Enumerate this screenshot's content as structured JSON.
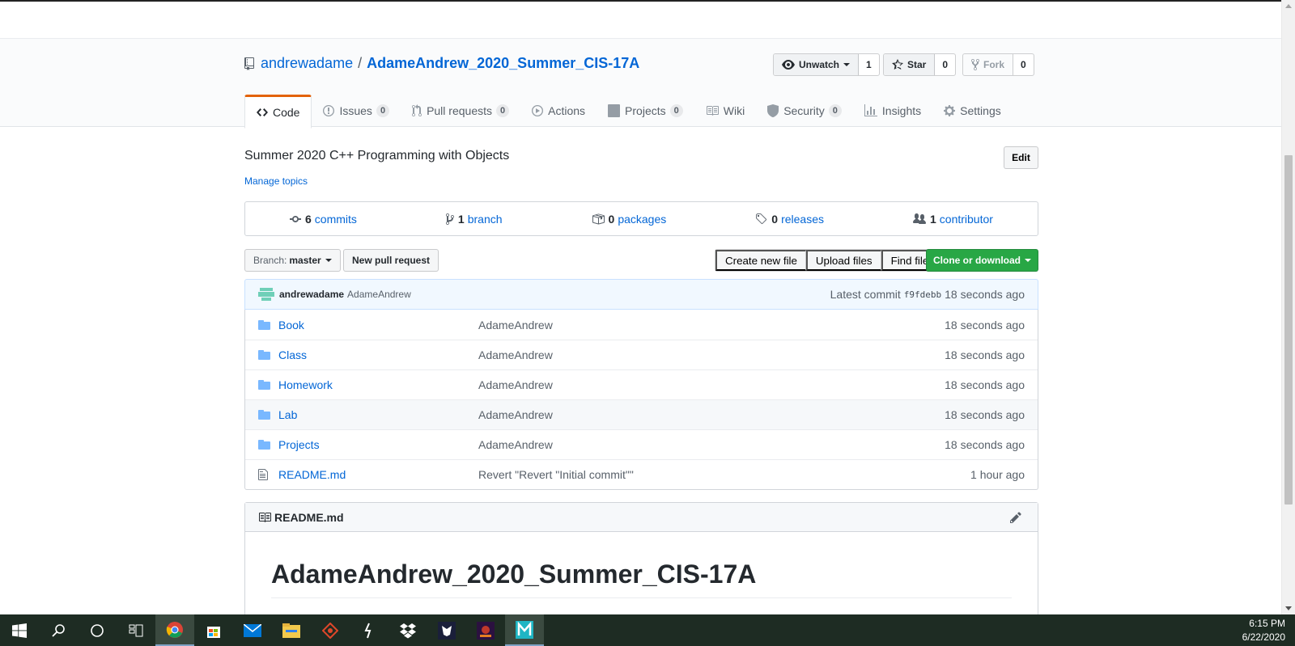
{
  "repo": {
    "owner": "andrewadame",
    "separator": "/",
    "name": "AdameAndrew_2020_Summer_CIS-17A"
  },
  "actions": {
    "watch_label": "Unwatch",
    "watch_count": "1",
    "star_label": "Star",
    "star_count": "0",
    "fork_label": "Fork",
    "fork_count": "0"
  },
  "tabs": [
    {
      "label": "Code",
      "count": "",
      "icon": "code-icon"
    },
    {
      "label": "Issues",
      "count": "0",
      "icon": "issue-icon"
    },
    {
      "label": "Pull requests",
      "count": "0",
      "icon": "pull-request-icon"
    },
    {
      "label": "Actions",
      "count": "",
      "icon": "play-icon"
    },
    {
      "label": "Projects",
      "count": "0",
      "icon": "project-icon"
    },
    {
      "label": "Wiki",
      "count": "",
      "icon": "book-icon"
    },
    {
      "label": "Security",
      "count": "0",
      "icon": "shield-icon"
    },
    {
      "label": "Insights",
      "count": "",
      "icon": "graph-icon"
    },
    {
      "label": "Settings",
      "count": "",
      "icon": "gear-icon"
    }
  ],
  "description": "Summer 2020 C++ Programming with Objects",
  "manage_topics": "Manage topics",
  "edit_label": "Edit",
  "summary": {
    "commits_num": "6",
    "commits_label": "commits",
    "branch_num": "1",
    "branch_label": "branch",
    "packages_num": "0",
    "packages_label": "packages",
    "releases_num": "0",
    "releases_label": "releases",
    "contributor_num": "1",
    "contributor_label": "contributor"
  },
  "toolbar": {
    "branch_prefix": "Branch:",
    "branch_name": "master",
    "new_pr": "New pull request",
    "create_file": "Create new file",
    "upload_files": "Upload files",
    "find_file": "Find file",
    "clone": "Clone or download"
  },
  "commit": {
    "author": "andrewadame",
    "message": "AdameAndrew",
    "latest_prefix": "Latest commit",
    "sha": "f9fdebb",
    "age": "18 seconds ago"
  },
  "files": [
    {
      "name": "Book",
      "type": "folder",
      "message": "AdameAndrew",
      "age": "18 seconds ago"
    },
    {
      "name": "Class",
      "type": "folder",
      "message": "AdameAndrew",
      "age": "18 seconds ago"
    },
    {
      "name": "Homework",
      "type": "folder",
      "message": "AdameAndrew",
      "age": "18 seconds ago"
    },
    {
      "name": "Lab",
      "type": "folder",
      "message": "AdameAndrew",
      "age": "18 seconds ago"
    },
    {
      "name": "Projects",
      "type": "folder",
      "message": "AdameAndrew",
      "age": "18 seconds ago"
    },
    {
      "name": "README.md",
      "type": "file",
      "message": "Revert \"Revert \"Initial commit\"\"",
      "age": "1 hour ago"
    }
  ],
  "readme": {
    "filename": "README.md",
    "heading": "AdameAndrew_2020_Summer_CIS-17A"
  },
  "taskbar": {
    "time": "6:15 PM",
    "date": "6/22/2020"
  },
  "colors": {
    "link": "#0366d6",
    "accent_tab": "#e36209",
    "clone_green": "#28a745",
    "taskbar": "#1e2c23"
  }
}
